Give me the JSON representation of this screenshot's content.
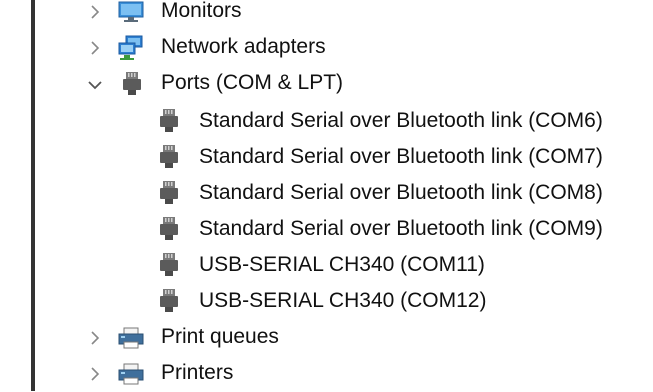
{
  "device_tree": {
    "categories": [
      {
        "label": "Monitors",
        "expanded": false,
        "icon": "monitor-icon"
      },
      {
        "label": "Network adapters",
        "expanded": false,
        "icon": "network-adapter-icon"
      },
      {
        "label": "Ports (COM & LPT)",
        "expanded": true,
        "icon": "port-connector-icon",
        "children": [
          {
            "label": "Standard Serial over Bluetooth link (COM6)",
            "icon": "port-connector-icon"
          },
          {
            "label": "Standard Serial over Bluetooth link (COM7)",
            "icon": "port-connector-icon"
          },
          {
            "label": "Standard Serial over Bluetooth link (COM8)",
            "icon": "port-connector-icon"
          },
          {
            "label": "Standard Serial over Bluetooth link (COM9)",
            "icon": "port-connector-icon"
          },
          {
            "label": "USB-SERIAL CH340 (COM11)",
            "icon": "port-connector-icon"
          },
          {
            "label": "USB-SERIAL CH340 (COM12)",
            "icon": "port-connector-icon"
          }
        ]
      },
      {
        "label": "Print queues",
        "expanded": false,
        "icon": "printer-icon"
      },
      {
        "label": "Printers",
        "expanded": false,
        "icon": "printer-icon"
      }
    ]
  },
  "colors": {
    "chevron": "#888888",
    "border": "#333333",
    "monitor": "#3a8fd8",
    "network": "#2d7fd1",
    "plug": "#5b5b5b"
  }
}
